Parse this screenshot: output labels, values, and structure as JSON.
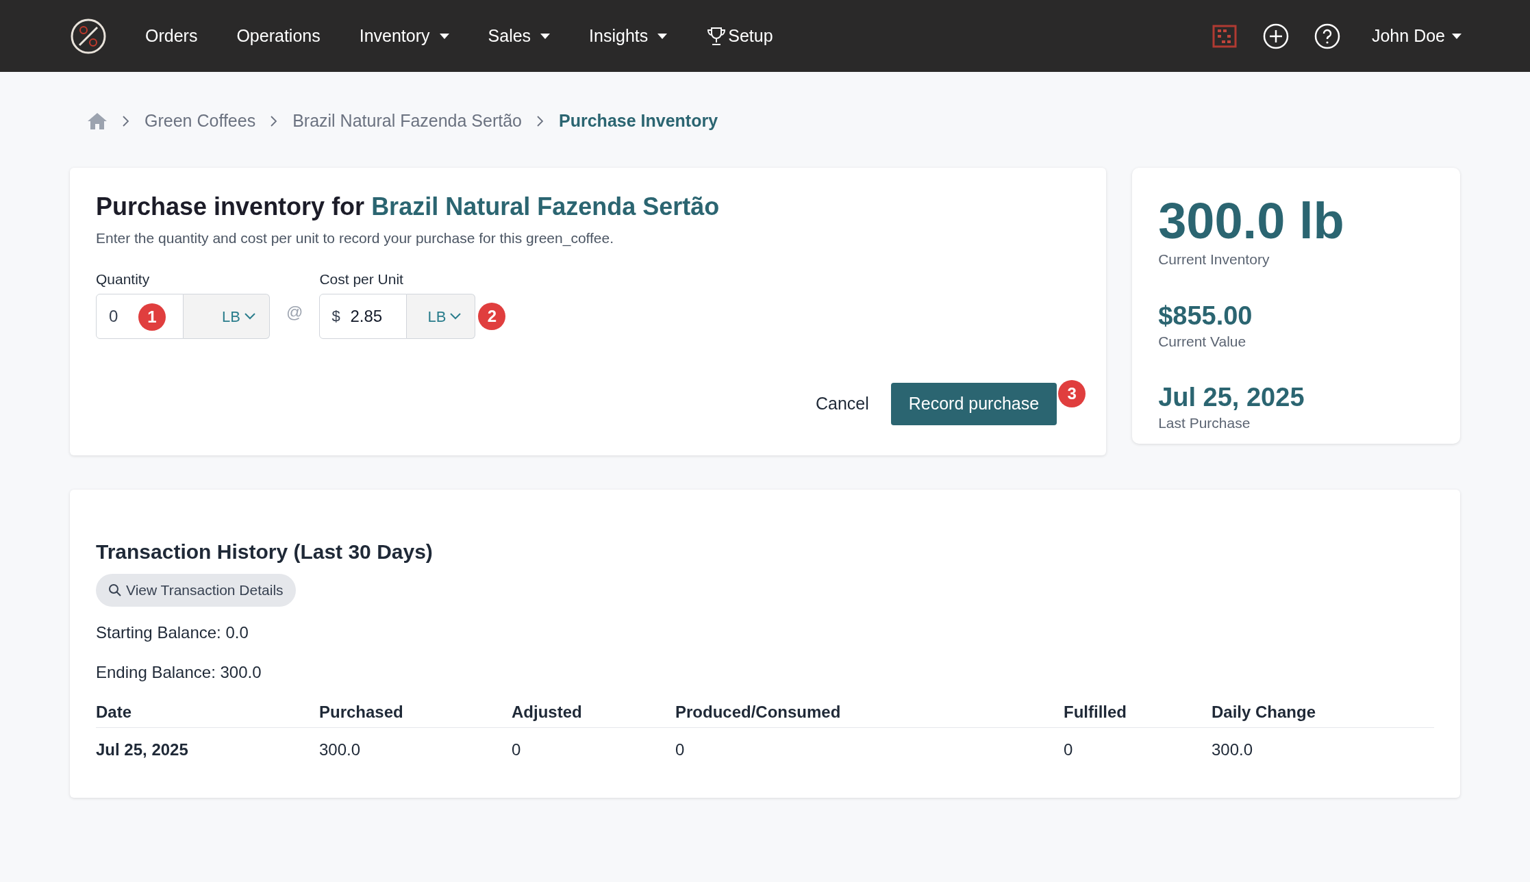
{
  "nav": {
    "items": [
      {
        "label": "Orders",
        "has_menu": false,
        "kind": "plain"
      },
      {
        "label": "Operations",
        "has_menu": false,
        "kind": "plain"
      },
      {
        "label": "Inventory",
        "has_menu": true,
        "kind": "plain"
      },
      {
        "label": "Sales",
        "has_menu": true,
        "kind": "plain"
      },
      {
        "label": "Insights",
        "has_menu": true,
        "kind": "plain"
      },
      {
        "label": "Setup",
        "has_menu": false,
        "kind": "trophy"
      }
    ],
    "user": "John Doe"
  },
  "breadcrumb": [
    {
      "label": "Green Coffees",
      "current": false
    },
    {
      "label": "Brazil Natural Fazenda Sertão",
      "current": false
    },
    {
      "label": "Purchase Inventory",
      "current": true
    }
  ],
  "form": {
    "title": "Purchase inventory for",
    "product": "Brazil Natural Fazenda Sertão",
    "description": "Enter the quantity and cost per unit to record your purchase for this green_coffee.",
    "quantity": {
      "label": "Quantity",
      "value": "0",
      "unit": "LB",
      "marker": "1"
    },
    "separator": "@",
    "cost": {
      "label": "Cost per Unit",
      "prefix": "$",
      "value": "2.85",
      "unit": "LB",
      "marker": "2"
    },
    "cancel": "Cancel",
    "submit": "Record purchase",
    "submit_marker": "3"
  },
  "stats": [
    {
      "value": "300.0 lb",
      "label": "Current Inventory"
    },
    {
      "value": "$855.00",
      "label": "Current Value"
    },
    {
      "value": "Jul 25, 2025",
      "label": "Last Purchase"
    }
  ],
  "history": {
    "title": "Transaction History (Last 30 Days)",
    "details_button": "View Transaction Details",
    "starting": "Starting Balance: 0.0",
    "ending": "Ending Balance: 300.0",
    "table": {
      "columns": [
        "Date",
        "Purchased",
        "Adjusted",
        "Produced/Consumed",
        "Fulfilled",
        "Daily Change"
      ],
      "rows": [
        [
          "Jul 25, 2025",
          "300.0",
          "0",
          "0",
          "0",
          "300.0"
        ]
      ]
    }
  }
}
